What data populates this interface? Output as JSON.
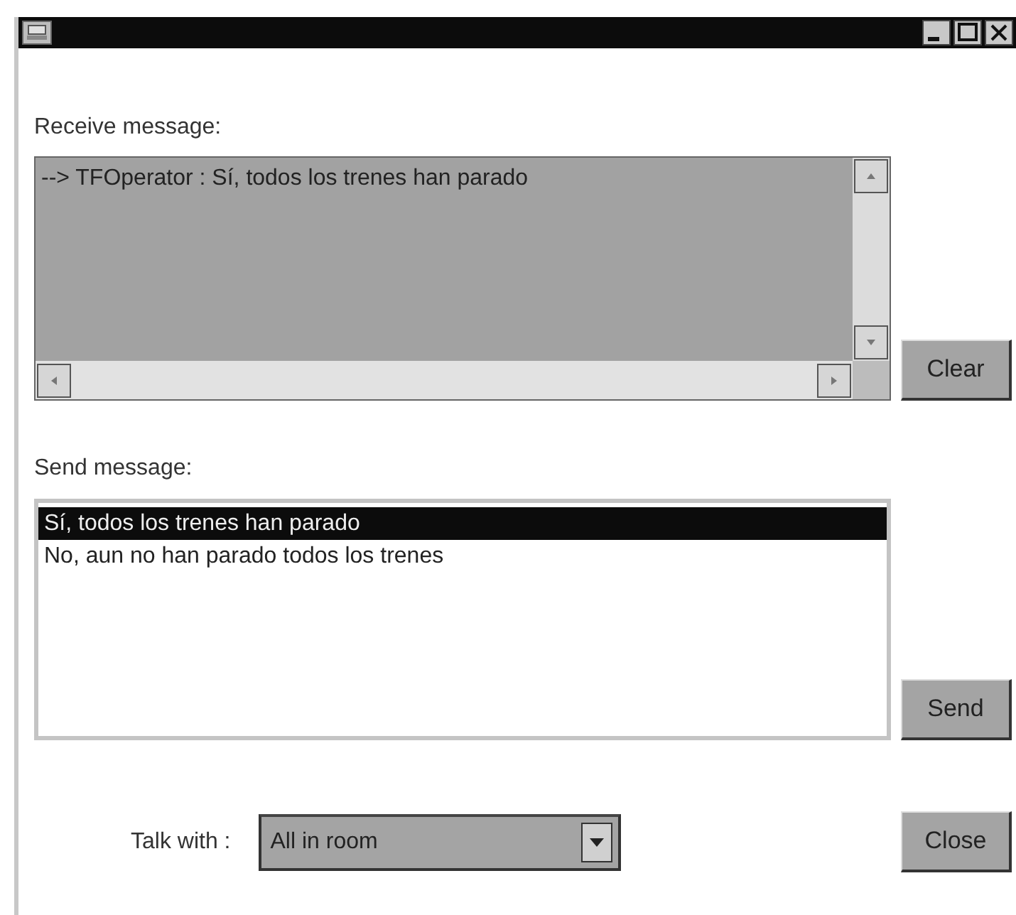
{
  "receive": {
    "label": "Receive message:",
    "lines": [
      "--> TFOperator : Sí, todos los trenes han parado"
    ]
  },
  "clear_button": "Clear",
  "send": {
    "label": "Send message:",
    "options": [
      {
        "text": "Sí, todos los trenes han parado",
        "selected": true
      },
      {
        "text": "No, aun no han parado todos los trenes",
        "selected": false
      }
    ]
  },
  "send_button": "Send",
  "talk_with": {
    "label": "Talk with :",
    "value": "All in room"
  },
  "close_button": "Close"
}
